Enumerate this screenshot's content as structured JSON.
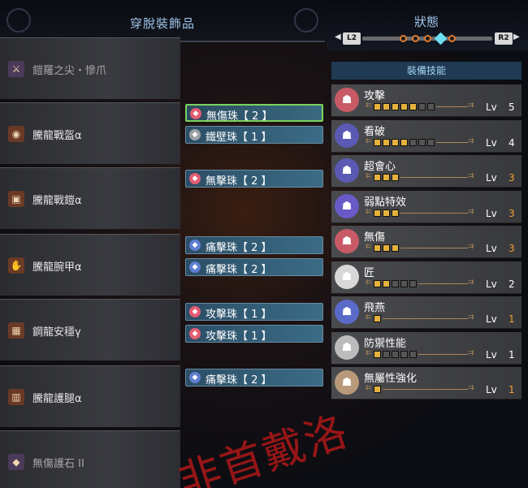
{
  "left_panel": {
    "title": "穿脫裝飾品",
    "equipment": [
      {
        "name": "鎧羅之尖・慘爪",
        "icon": "weapon-icon",
        "glyph": "⚔",
        "dim": true
      },
      {
        "name": "騰龍戰盔α",
        "icon": "helm-icon",
        "glyph": "◉"
      },
      {
        "name": "騰龍戰鎧α",
        "icon": "chest-armor-icon",
        "glyph": "▣"
      },
      {
        "name": "騰龍腕甲α",
        "icon": "arm-armor-icon",
        "glyph": "✋"
      },
      {
        "name": "鋼龍安穩γ",
        "icon": "waist-armor-icon",
        "glyph": "▦"
      },
      {
        "name": "騰龍護腿α",
        "icon": "leg-armor-icon",
        "glyph": "▥"
      },
      {
        "name": "無傷護石 II",
        "icon": "charm-icon",
        "glyph": "◆",
        "dim": true
      }
    ],
    "jewels": [
      {
        "label": "無傷珠【 2 】",
        "color": "red",
        "selected": true
      },
      {
        "label": "鐵壁珠【 1 】",
        "color": "grey"
      },
      {
        "label": "無擊珠【 2 】",
        "color": "red"
      },
      {
        "label": "痛擊珠【 2 】",
        "color": "blue"
      },
      {
        "label": "痛擊珠【 2 】",
        "color": "blue"
      },
      {
        "label": "攻擊珠【 1 】",
        "color": "red"
      },
      {
        "label": "攻擊珠【 1 】",
        "color": "red"
      },
      {
        "label": "痛擊珠【 2 】",
        "color": "blue"
      }
    ]
  },
  "right_panel": {
    "title": "狀態",
    "nav": {
      "left": "L2",
      "right": "R2",
      "left_arrow": "◀",
      "right_arrow": "▶",
      "pages": 5,
      "active_page": 4
    },
    "skills_title": "裝備技能",
    "lv_label": "Lv",
    "skills": [
      {
        "name": "攻擊",
        "level": "5",
        "max": 7,
        "icon_color": "#c85a66",
        "lv_color": "#ffffff"
      },
      {
        "name": "看破",
        "level": "4",
        "max": 7,
        "icon_color": "#5a5ab4",
        "lv_color": "#ffffff"
      },
      {
        "name": "超會心",
        "level": "3",
        "max": 3,
        "icon_color": "#5a5ab4",
        "lv_color": "#f0a030"
      },
      {
        "name": "弱點特效",
        "level": "3",
        "max": 3,
        "icon_color": "#6a5ac8",
        "lv_color": "#f0a030"
      },
      {
        "name": "無傷",
        "level": "3",
        "max": 3,
        "icon_color": "#c85a66",
        "lv_color": "#f0a030"
      },
      {
        "name": "匠",
        "level": "2",
        "max": 5,
        "icon_color": "#d8d8d8",
        "lv_color": "#ffffff"
      },
      {
        "name": "飛燕",
        "level": "1",
        "max": 1,
        "icon_color": "#5a6ac8",
        "lv_color": "#f0a030"
      },
      {
        "name": "防禦性能",
        "level": "1",
        "max": 5,
        "icon_color": "#bcbcbc",
        "lv_color": "#ffffff"
      },
      {
        "name": "無屬性強化",
        "level": "1",
        "max": 1,
        "icon_color": "#b89a7a",
        "lv_color": "#f0a030"
      }
    ]
  },
  "watermark": "非首戴洛"
}
